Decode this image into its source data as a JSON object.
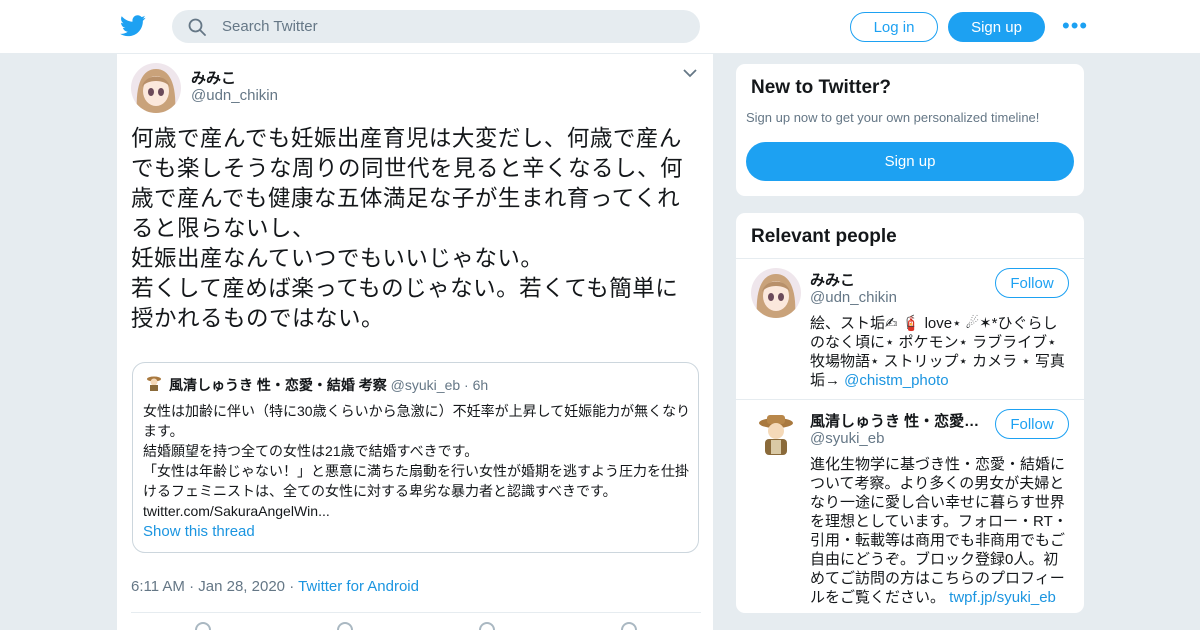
{
  "header": {
    "search_placeholder": "Search Twitter",
    "login_label": "Log in",
    "signup_label": "Sign up",
    "more_label": "•••"
  },
  "tweet": {
    "author_name": "みみこ",
    "author_handle": "@udn_chikin",
    "text": "何歳で産んでも妊娠出産育児は大変だし、何歳で産んでも楽しそうな周りの同世代を見ると辛くなるし、何歳で産んでも健康な五体満足な子が生まれ育ってくれると限らないし、\n妊娠出産なんていつでもいいじゃない。\n若くして産めば楽ってものじゃない。若くても簡単に授かれるものではない。",
    "quote": {
      "name": "風清しゅうき 性・恋愛・結婚 考察",
      "handle": "@syuki_eb",
      "time": "· 6h",
      "text": "女性は加齢に伴い（特に30歳くらいから急激に）不妊率が上昇して妊娠能力が無くなります。\n結婚願望を持つ全ての女性は21歳で結婚すべきです。\n「女性は年齢じゃない！」と悪意に満ちた扇動を行い女性が婚期を逃すよう圧力を仕掛けるフェミニストは、全ての女性に対する卑劣な暴力者と認識すべきです。 twitter.com/SakuraAngelWin...",
      "show_thread": "Show this thread"
    },
    "time": "6:11 AM",
    "date": "Jan 28, 2020",
    "source": "Twitter for Android"
  },
  "new_to_twitter": {
    "title": "New to Twitter?",
    "subtitle": "Sign up now to get your own personalized timeline!",
    "button": "Sign up"
  },
  "relevant_people": {
    "title": "Relevant people",
    "people": [
      {
        "name": "みみこ",
        "handle": "@udn_chikin",
        "follow": "Follow",
        "bio": "絵、スト垢✍ 🧯 love⋆ ☄✶*ひぐらしのなく頃に⋆ ポケモン⋆ ラブライブ⋆ 牧場物語⋆ ストリップ⋆ カメラ ⋆ 写真垢→ ",
        "bio_link": "@chistm_photo"
      },
      {
        "name": "風清しゅうき 性・恋愛…",
        "handle": "@syuki_eb",
        "follow": "Follow",
        "bio": "進化生物学に基づき性・恋愛・結婚について考察。より多くの男女が夫婦となり一途に愛し合い幸せに暮らす世界を理想としています。フォロー・RT・引用・転載等は商用でも非商用でもご自由にどうぞ。ブロック登録0人。初めてご訪問の方はこちらのプロフィールをご覧ください。 ",
        "bio_link": "twpf.jp/syuki_eb"
      }
    ]
  },
  "colors": {
    "brand": "#1da1f2",
    "link": "#1b95e0",
    "muted": "#657786",
    "background": "#e6ecf0"
  },
  "icons": [
    "twitter-bird-icon",
    "search-icon",
    "more-dots-icon",
    "chevron-down-icon"
  ]
}
